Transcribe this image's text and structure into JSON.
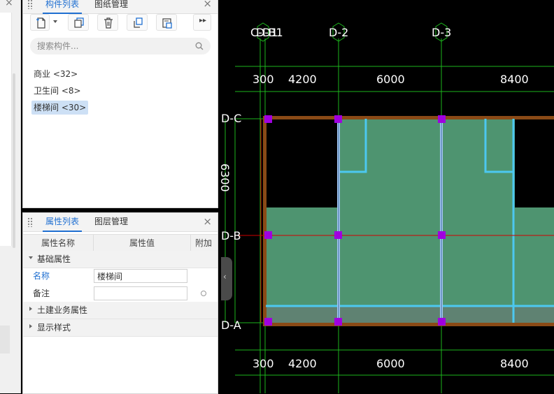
{
  "component_panel": {
    "tabs": [
      {
        "label": "构件列表",
        "active": true
      },
      {
        "label": "图纸管理",
        "active": false
      }
    ],
    "search_placeholder": "搜索构件...",
    "items": [
      {
        "label": "商业 <32>",
        "selected": false
      },
      {
        "label": "卫生间 <8>",
        "selected": false
      },
      {
        "label": "楼梯间 <30>",
        "selected": true
      }
    ],
    "toolbar_icons": [
      "new-icon",
      "dropdown-arrow-icon",
      "copy-icon",
      "delete-icon",
      "copy-to-icon",
      "layer-copy-icon",
      "more-icon"
    ]
  },
  "property_panel": {
    "tabs": [
      {
        "label": "属性列表",
        "active": true
      },
      {
        "label": "图层管理",
        "active": false
      }
    ],
    "columns": [
      "属性名称",
      "属性值",
      "附加"
    ],
    "sections": {
      "basic": "基础属性",
      "civil": "土建业务属性",
      "display": "显示样式"
    },
    "rows": [
      {
        "key": "名称",
        "value": "楼梯间"
      },
      {
        "key": "备注",
        "value": ""
      }
    ]
  },
  "cad": {
    "colors": {
      "background": "#000000",
      "grid": "#1db51d",
      "region": "#4e9470",
      "wall": "#8a4a16",
      "beam": "#4cc8f0",
      "column": "#a000e0",
      "axis_red": "#d00000"
    },
    "column_axes": [
      "D-B1",
      "D-2",
      "D-3"
    ],
    "row_axes": [
      "D-C",
      "D-B",
      "D-A"
    ],
    "overlap_label": "C-D1",
    "top_dims": [
      "300",
      "4200",
      "6000",
      "8400"
    ],
    "bottom_dims": [
      "300",
      "4200",
      "6000",
      "8400"
    ],
    "side_dim": "6300"
  }
}
